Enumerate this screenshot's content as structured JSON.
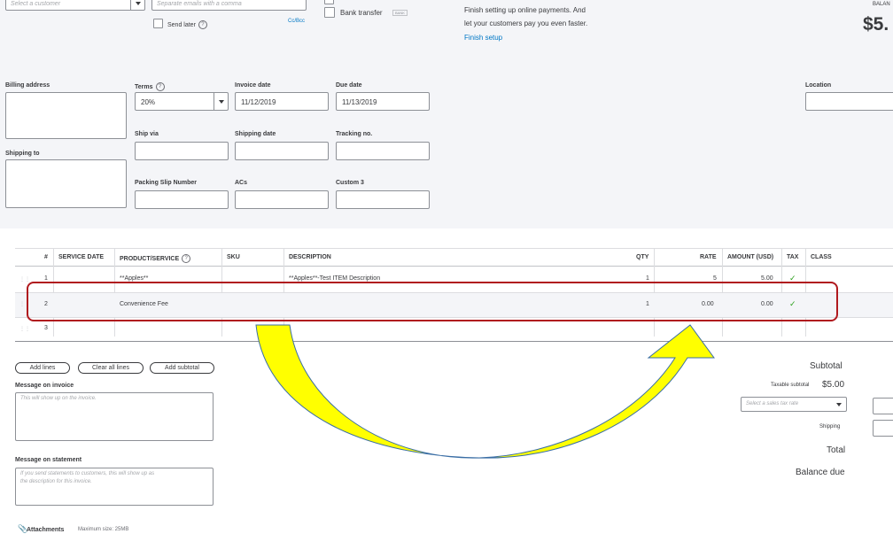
{
  "header": {
    "customer_placeholder": "Select a customer",
    "email_placeholder": "Separate emails with a comma",
    "send_later_label": "Send later",
    "cc_bcc_link": "Cc/Bcc",
    "bank_transfer_label": "Bank transfer",
    "bank_badge": "BANK",
    "online_payments_text_1": "Finish setting up online payments. And",
    "online_payments_text_2": "let your customers pay you even faster.",
    "finish_setup_link": "Finish setup",
    "balance_label": "BALAN",
    "balance_amount": "$5."
  },
  "details": {
    "billing_address_label": "Billing address",
    "shipping_to_label": "Shipping to",
    "terms_label": "Terms",
    "terms_value": "20%",
    "invoice_date_label": "Invoice date",
    "invoice_date_value": "11/12/2019",
    "due_date_label": "Due date",
    "due_date_value": "11/13/2019",
    "location_label": "Location",
    "ship_via_label": "Ship via",
    "shipping_date_label": "Shipping date",
    "tracking_no_label": "Tracking no.",
    "packing_slip_label": "Packing Slip Number",
    "acs_label": "ACs",
    "custom3_label": "Custom 3"
  },
  "table": {
    "headers": {
      "num": "#",
      "service_date": "SERVICE DATE",
      "product": "PRODUCT/SERVICE",
      "sku": "SKU",
      "description": "DESCRIPTION",
      "qty": "QTY",
      "rate": "RATE",
      "amount": "AMOUNT (USD)",
      "tax": "TAX",
      "class": "CLASS"
    },
    "rows": [
      {
        "num": "1",
        "product": "**Apples**",
        "description": "**Apples**-Test ITEM Description",
        "qty": "1",
        "rate": "5",
        "amount": "5.00"
      },
      {
        "num": "2",
        "product": "Convenience Fee",
        "description": "",
        "qty": "1",
        "rate": "0.00",
        "amount": "0.00"
      },
      {
        "num": "3",
        "product": "",
        "description": "",
        "qty": "",
        "rate": "",
        "amount": ""
      }
    ]
  },
  "actions": {
    "add_lines": "Add lines",
    "clear_all_lines": "Clear all lines",
    "add_subtotal": "Add subtotal"
  },
  "messages": {
    "invoice_label": "Message on invoice",
    "invoice_placeholder": "This will show up on the invoice.",
    "statement_label": "Message on statement",
    "statement_placeholder_1": "If you send statements to customers, this will show up as",
    "statement_placeholder_2": "the description for this invoice."
  },
  "attachments": {
    "label": "Attachments",
    "max_size": "Maximum size: 25MB"
  },
  "summary": {
    "subtotal_label": "Subtotal",
    "taxable_subtotal_label": "Taxable subtotal",
    "taxable_subtotal_value": "$5.00",
    "sales_tax_placeholder": "Select a sales tax rate",
    "shipping_label": "Shipping",
    "total_label": "Total",
    "balance_due_label": "Balance due"
  },
  "colors": {
    "annotation_box": "#b0191e",
    "arrow_fill": "#ffff00",
    "arrow_stroke": "#3a6ea5",
    "accent_link": "#0077c5",
    "tax_check": "#2ca01c"
  }
}
